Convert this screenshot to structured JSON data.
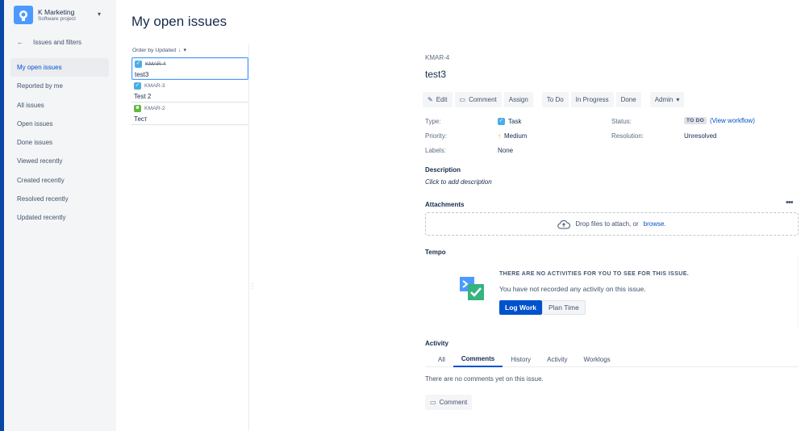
{
  "project": {
    "name": "K Marketing",
    "type": "Software project"
  },
  "sidebar": {
    "back_label": "Issues and filters",
    "items": [
      {
        "label": "My open issues",
        "active": true
      },
      {
        "label": "Reported by me"
      },
      {
        "label": "All issues"
      },
      {
        "label": "Open issues"
      },
      {
        "label": "Done issues"
      },
      {
        "label": "Viewed recently"
      },
      {
        "label": "Created recently"
      },
      {
        "label": "Resolved recently"
      },
      {
        "label": "Updated recently"
      }
    ]
  },
  "list": {
    "title": "My open issues",
    "order_label": "Order by Updated",
    "issues": [
      {
        "key": "KMAR-4",
        "summary": "test3",
        "type": "task",
        "done": true
      },
      {
        "key": "KMAR-3",
        "summary": "Test 2",
        "type": "task",
        "done": false
      },
      {
        "key": "KMAR-2",
        "summary": "Тест",
        "type": "story",
        "done": false
      }
    ]
  },
  "detail": {
    "key": "KMAR-4",
    "summary": "test3",
    "toolbar": {
      "edit": "Edit",
      "comment": "Comment",
      "assign": "Assign",
      "todo": "To Do",
      "inprogress": "In Progress",
      "done": "Done",
      "admin": "Admin"
    },
    "fields": {
      "type_label": "Type:",
      "type_value": "Task",
      "priority_label": "Priority:",
      "priority_value": "Medium",
      "labels_label": "Labels:",
      "labels_value": "None",
      "status_label": "Status:",
      "status_value": "TO DO",
      "view_workflow": "View workflow",
      "resolution_label": "Resolution:",
      "resolution_value": "Unresolved"
    },
    "description_heading": "Description",
    "description_placeholder": "Click to add description",
    "attachments_heading": "Attachments",
    "dropzone_text": "Drop files to attach, or",
    "dropzone_link": "browse.",
    "tempo": {
      "heading": "Tempo",
      "title": "THERE ARE NO ACTIVITIES FOR YOU TO SEE FOR THIS ISSUE.",
      "message": "You have not recorded any activity on this issue.",
      "log_work": "Log Work",
      "plan_time": "Plan Time"
    },
    "activity": {
      "heading": "Activity",
      "tabs": [
        "All",
        "Comments",
        "History",
        "Activity",
        "Worklogs"
      ],
      "active_tab": "Comments",
      "empty_text": "There are no comments yet on this issue.",
      "comment_button": "Comment"
    }
  },
  "colors": {
    "brand": "#0747a6",
    "link": "#0052cc",
    "selected_border": "#4c9aff"
  }
}
